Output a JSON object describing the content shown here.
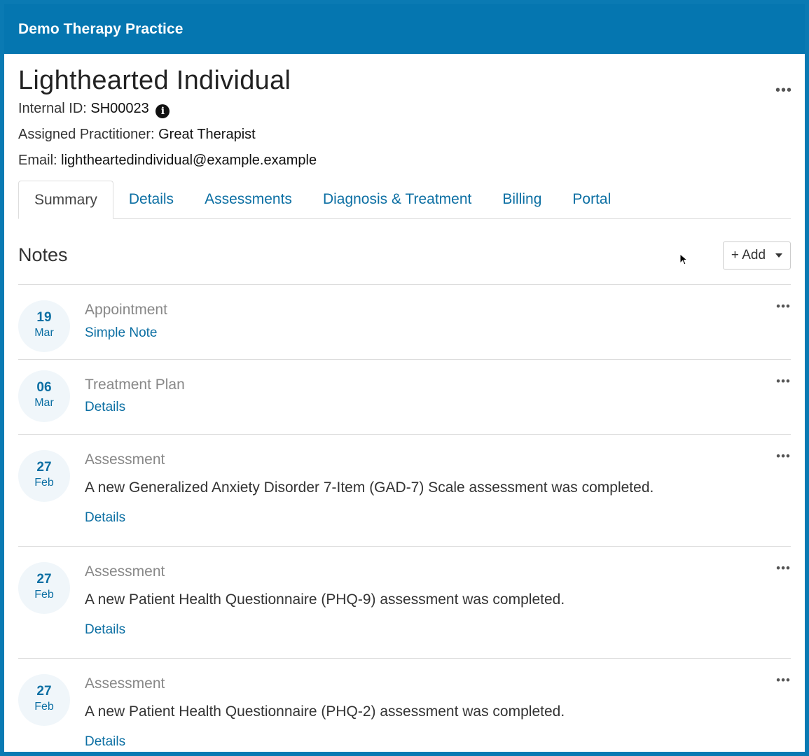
{
  "app": {
    "title": "Demo Therapy Practice"
  },
  "client": {
    "name": "Lighthearted Individual",
    "menu_label": "•••",
    "internal_id_label": "Internal ID: ",
    "internal_id": "SH00023",
    "practitioner_label": "Assigned Practitioner: ",
    "practitioner": "Great Therapist",
    "email_label": "Email: ",
    "email": "lightheartedindividual@example.example"
  },
  "tabs": [
    {
      "label": "Summary",
      "active": true
    },
    {
      "label": "Details"
    },
    {
      "label": "Assessments"
    },
    {
      "label": "Diagnosis & Treatment"
    },
    {
      "label": "Billing"
    },
    {
      "label": "Portal"
    }
  ],
  "notes": {
    "title": "Notes",
    "add_label": "+ Add",
    "items": [
      {
        "day": "19",
        "month": "Mar",
        "type": "Appointment",
        "link": "Simple Note",
        "menu": "•••"
      },
      {
        "day": "06",
        "month": "Mar",
        "type": "Treatment Plan",
        "link": "Details",
        "menu": "•••"
      },
      {
        "day": "27",
        "month": "Feb",
        "type": "Assessment",
        "description": "A new Generalized Anxiety Disorder 7-Item (GAD-7) Scale assessment was completed.",
        "link": "Details",
        "menu": "•••"
      },
      {
        "day": "27",
        "month": "Feb",
        "type": "Assessment",
        "description": "A new Patient Health Questionnaire (PHQ-9) assessment was completed.",
        "link": "Details",
        "menu": "•••"
      },
      {
        "day": "27",
        "month": "Feb",
        "type": "Assessment",
        "description": "A new Patient Health Questionnaire (PHQ-2) assessment was completed.",
        "link": "Details",
        "menu": "•••"
      }
    ]
  },
  "colors": {
    "brand": "#0576b0",
    "link": "#0c6fa3"
  }
}
